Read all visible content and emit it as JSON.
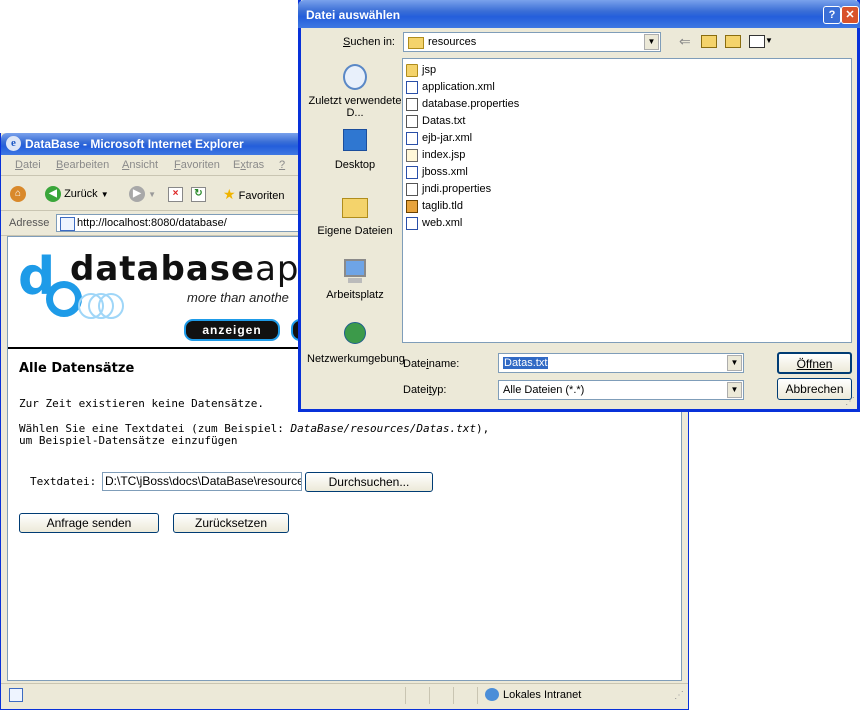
{
  "browser": {
    "title": "DataBase - Microsoft Internet Explorer",
    "menu": [
      "Datei",
      "Bearbeiten",
      "Ansicht",
      "Favoriten",
      "Extras",
      "?"
    ],
    "toolbar": {
      "back": "Zurück",
      "favorites": "Favoriten"
    },
    "address_label": "Adresse",
    "address_value": "http://localhost:8080/database/",
    "status_zone": "Lokales Intranet"
  },
  "page": {
    "logo_word_bold": "database",
    "logo_word_thin": "apc",
    "logo_letters": "db",
    "tagline": "more than anothe",
    "nav_anzeigen": "anzeigen",
    "heading": "Alle Datensätze",
    "no_records": "Zur Zeit existieren keine Datensätze.",
    "instruction_prefix": "Wählen Sie eine Textdatei (zum Beispiel: ",
    "instruction_example": "DataBase/resources/Datas.txt",
    "instruction_suffix": "),",
    "instruction_line2": "um Beispiel-Datensätze einzufügen",
    "textfile_label": "Textdatei:",
    "textfile_value": "D:\\TC\\jBoss\\docs\\DataBase\\resources\\Datas.txt",
    "browse_button": "Durchsuchen...",
    "submit_button": "Anfrage senden",
    "reset_button": "Zurücksetzen"
  },
  "dialog": {
    "title": "Datei auswählen",
    "look_in_label": "Suchen in:",
    "look_in_value": "resources",
    "places": [
      "Zuletzt verwendete D...",
      "Desktop",
      "Eigene Dateien",
      "Arbeitsplatz",
      "Netzwerkumgebung"
    ],
    "files": [
      {
        "name": "jsp",
        "type": "folder"
      },
      {
        "name": "application.xml",
        "type": "xml"
      },
      {
        "name": "database.properties",
        "type": "doc"
      },
      {
        "name": "Datas.txt",
        "type": "doc"
      },
      {
        "name": "ejb-jar.xml",
        "type": "xml"
      },
      {
        "name": "index.jsp",
        "type": "jsp"
      },
      {
        "name": "jboss.xml",
        "type": "xml"
      },
      {
        "name": "jndi.properties",
        "type": "doc"
      },
      {
        "name": "taglib.tld",
        "type": "tld"
      },
      {
        "name": "web.xml",
        "type": "xml"
      }
    ],
    "filename_label": "Dateiname:",
    "filename_value": "Datas.txt",
    "filetype_label": "Dateityp:",
    "filetype_value": "Alle Dateien (*.*)",
    "open_button": "Öffnen",
    "cancel_button": "Abbrechen"
  },
  "colors": {
    "xp_blue": "#245edb",
    "logo_blue": "#1e9be8",
    "selection": "#316ac5"
  }
}
